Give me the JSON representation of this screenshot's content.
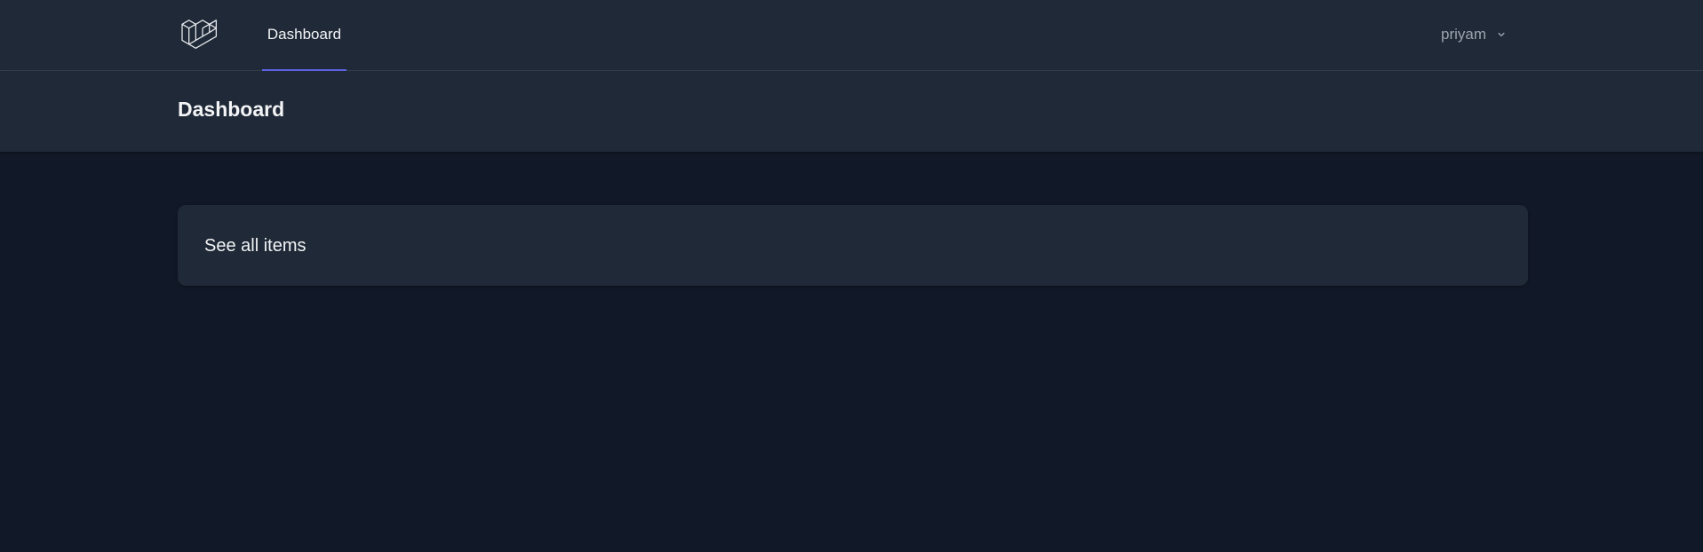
{
  "nav": {
    "logo_icon": "laravel-logo-icon",
    "links": [
      {
        "label": "Dashboard",
        "active": true
      }
    ],
    "user": {
      "name": "priyam",
      "icon": "chevron-down-icon"
    }
  },
  "header": {
    "title": "Dashboard"
  },
  "main": {
    "card_text": "See all items"
  },
  "colors": {
    "page_bg": "#111827",
    "panel_bg": "#1f2937",
    "accent": "#6366f1",
    "text_primary": "#f3f4f6",
    "text_muted": "#9ca3af"
  }
}
